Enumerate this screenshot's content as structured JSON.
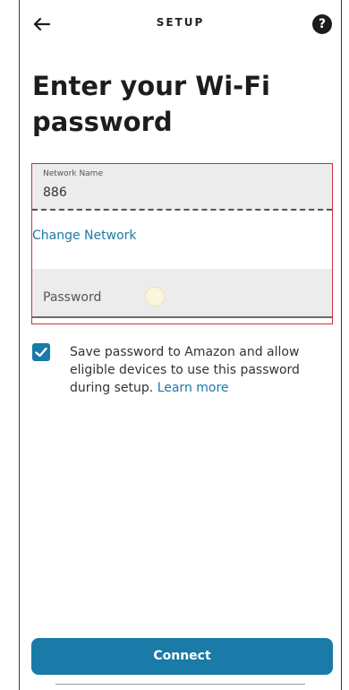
{
  "header": {
    "title": "SETUP",
    "back_icon": "arrow-left-icon",
    "help_icon": "question-circle-icon",
    "help_glyph": "?"
  },
  "page": {
    "headline": "Enter your Wi-Fi password"
  },
  "network": {
    "label": "Network Name",
    "value": "886",
    "change_link": "Change Network"
  },
  "password": {
    "placeholder": "Password",
    "value": ""
  },
  "consent": {
    "checked": true,
    "text": "Save password to Amazon and allow eligible devices to use this password during setup.",
    "learn_more": "Learn more"
  },
  "actions": {
    "connect_label": "Connect"
  },
  "colors": {
    "accent": "#1a7aa8",
    "highlight_border": "#d0303a",
    "field_bg": "#ececec"
  }
}
